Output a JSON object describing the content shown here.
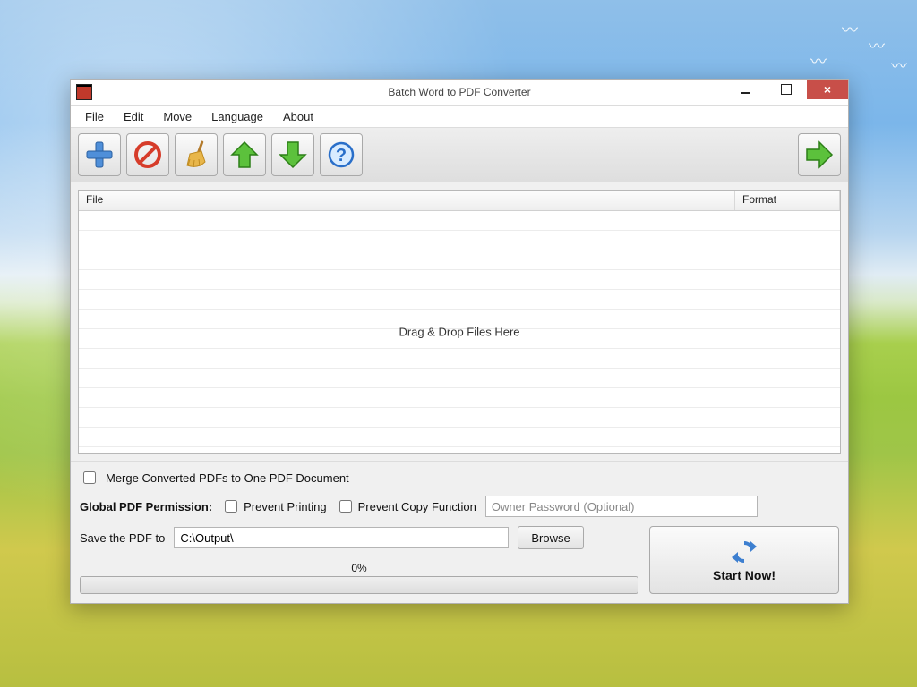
{
  "window": {
    "title": "Batch Word to PDF Converter"
  },
  "menu": {
    "file": "File",
    "edit": "Edit",
    "move": "Move",
    "language": "Language",
    "about": "About"
  },
  "toolbar": {
    "add": "Add",
    "remove": "Remove",
    "clear": "Clear",
    "move_up": "Move Up",
    "move_down": "Move Down",
    "help": "Help",
    "convert": "Convert"
  },
  "list": {
    "col_file": "File",
    "col_format": "Format",
    "drop_message": "Drag & Drop Files Here"
  },
  "options": {
    "merge_label": "Merge Converted PDFs to One PDF Document",
    "perm_title": "Global PDF Permission:",
    "prevent_print": "Prevent Printing",
    "prevent_copy": "Prevent Copy Function",
    "owner_password_placeholder": "Owner Password (Optional)",
    "save_label": "Save the PDF to",
    "save_path": "C:\\Output\\",
    "browse": "Browse",
    "progress_text": "0%",
    "start_label": "Start Now!"
  }
}
